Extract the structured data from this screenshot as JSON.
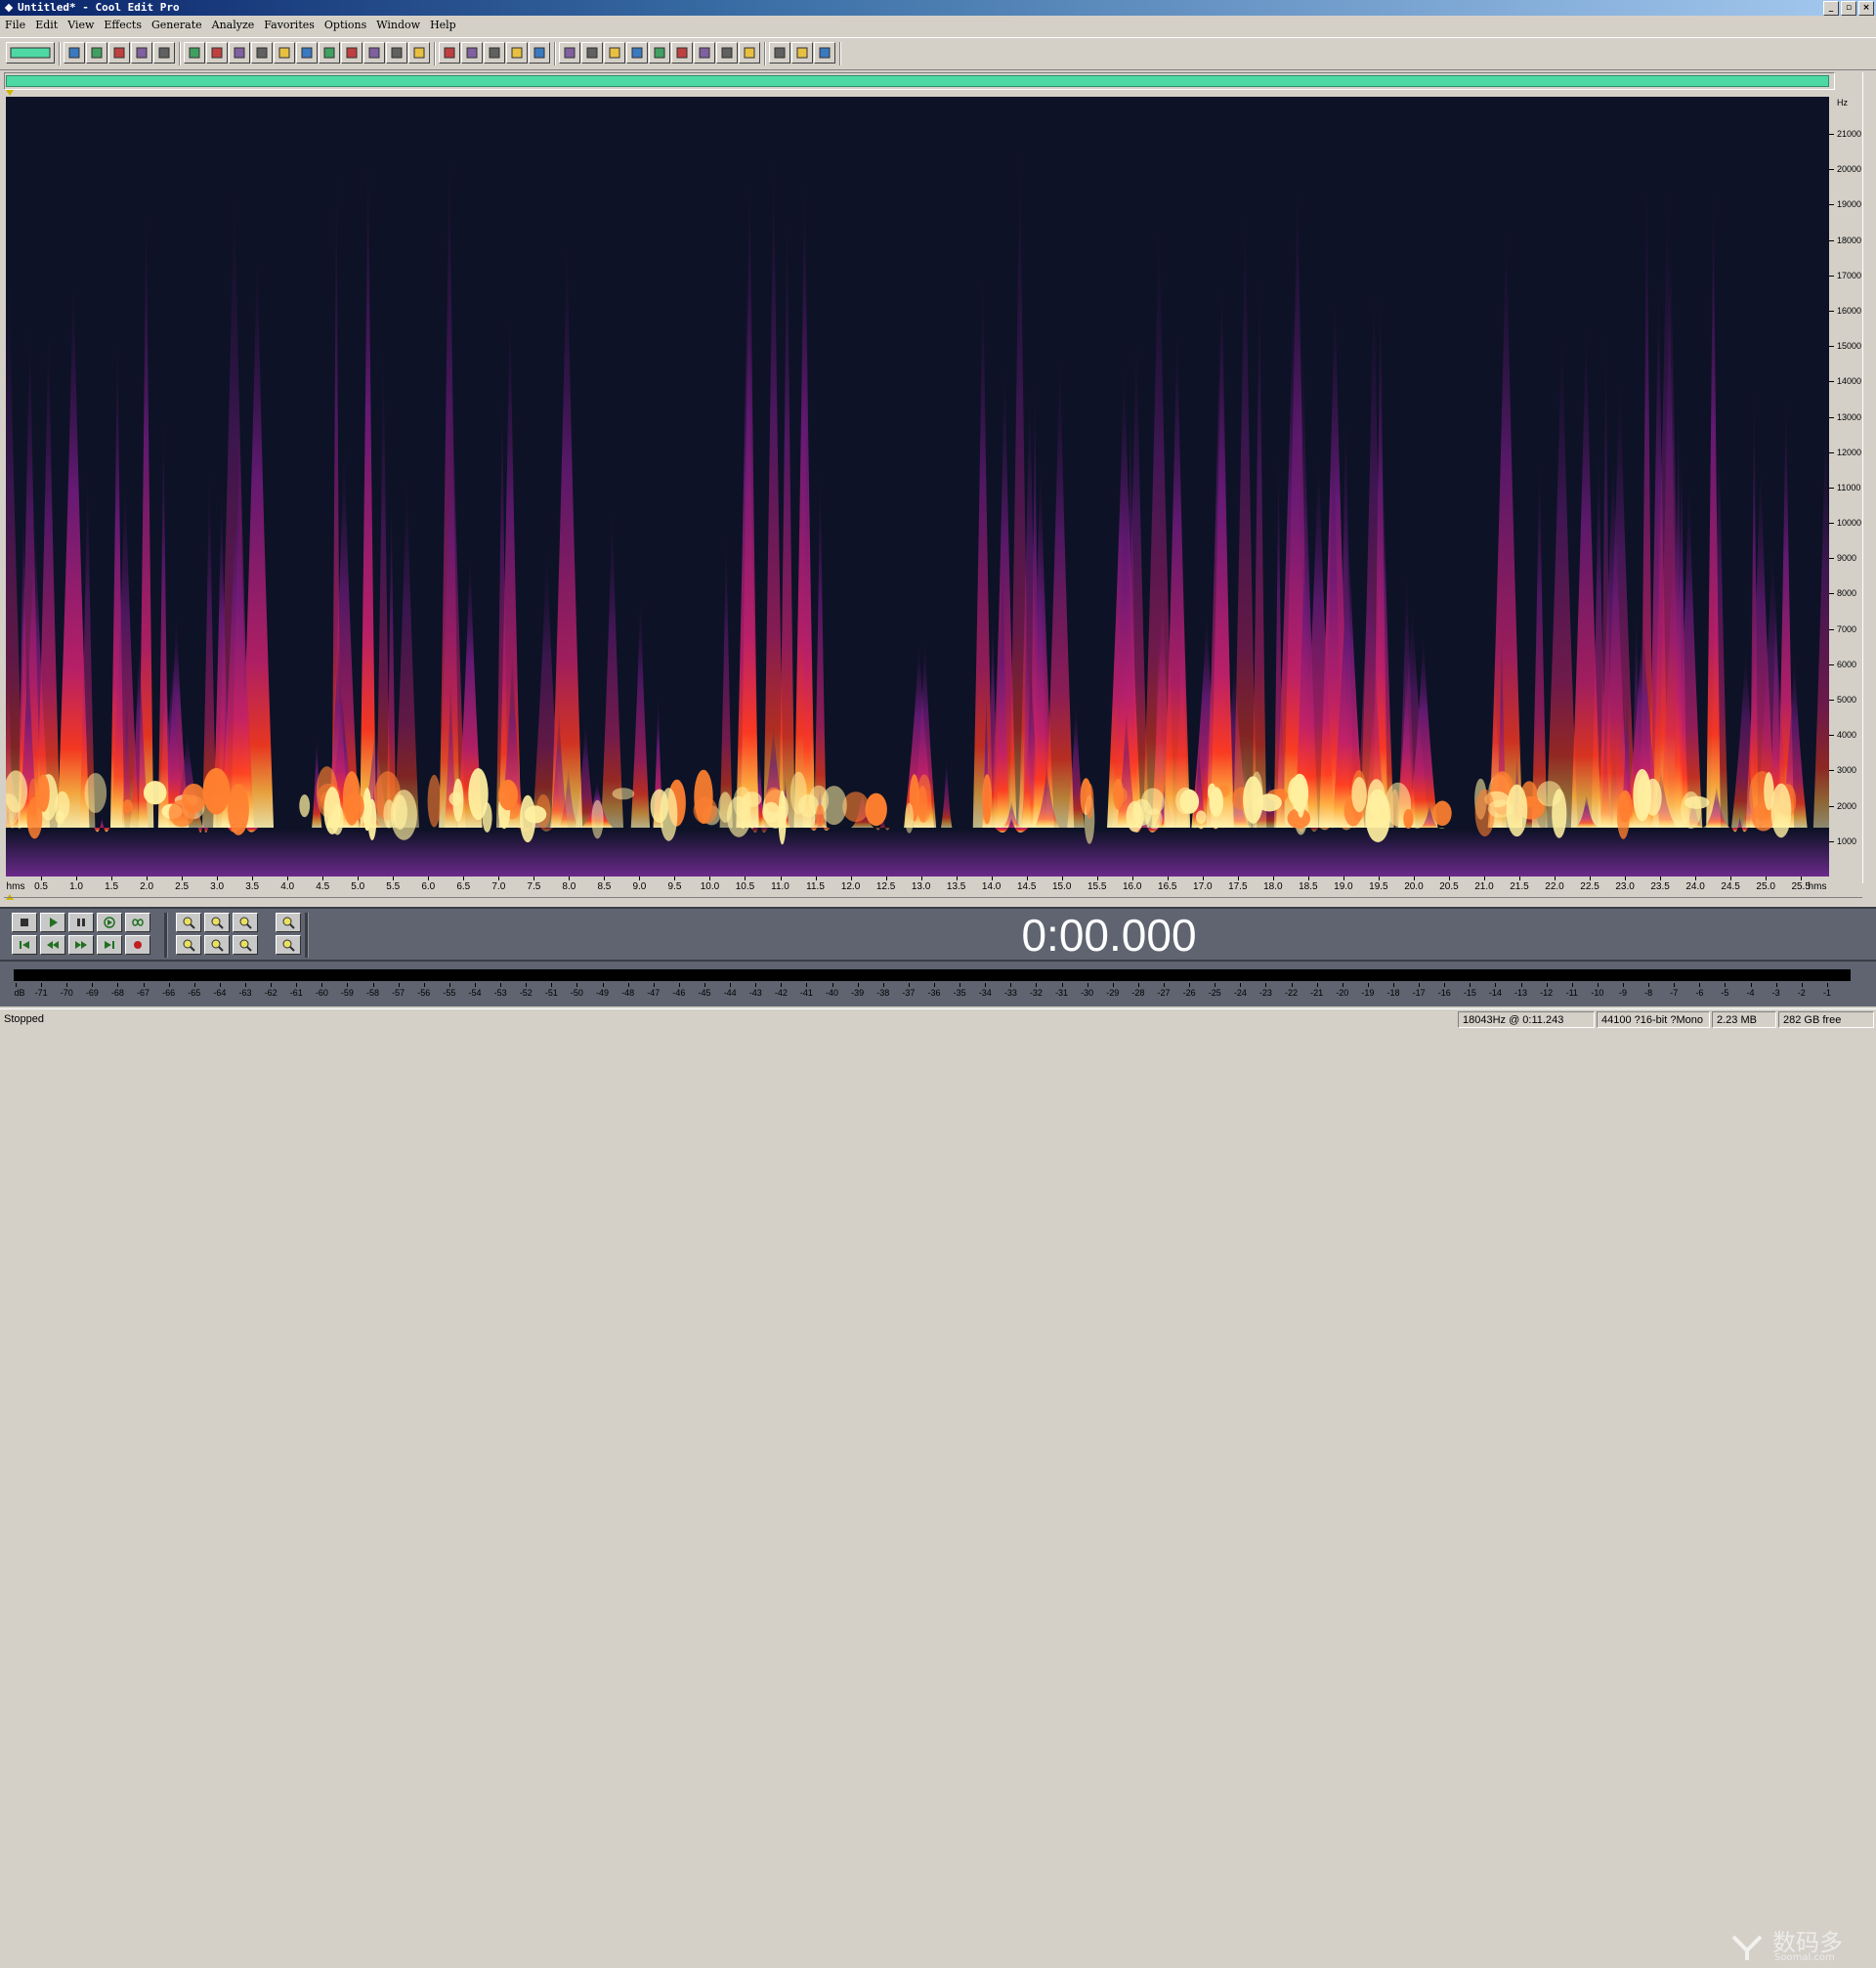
{
  "window": {
    "title": "Untitled* - Cool Edit Pro",
    "buttons": [
      "_",
      "▫",
      "×"
    ]
  },
  "menu": [
    "File",
    "Edit",
    "View",
    "Effects",
    "Generate",
    "Analyze",
    "Favorites",
    "Options",
    "Window",
    "Help"
  ],
  "toolbar": {
    "groups": [
      [
        "waveform-multitrack-toggle"
      ],
      [
        "new-icon",
        "open-icon",
        "save-icon",
        "save-all-icon",
        "close-icon"
      ],
      [
        "undo-icon",
        "redo-icon",
        "repeat-icon",
        "copy-icon",
        "copy-new-icon",
        "cut-icon",
        "paste-icon",
        "paste-new-icon",
        "mix-paste-icon",
        "paste-special-icon",
        "record-icon"
      ],
      [
        "view-waveform-icon",
        "view-envelope-icon",
        "view-spectral-icon",
        "view-spectral-alt-icon",
        "view-phase-icon"
      ],
      [
        "grid-icon",
        "cue-list-icon",
        "play-list-icon",
        "playback-icon",
        "zoom-icon",
        "time-format-icon",
        "snap-icon",
        "status-icon",
        "info-icon"
      ],
      [
        "settings-icon",
        "script-icon",
        "help-icon"
      ]
    ]
  },
  "spectrogram": {
    "hz_unit": "Hz",
    "hz_labels": [
      "21000",
      "20000",
      "19000",
      "18000",
      "17000",
      "16000",
      "15000",
      "14000",
      "13000",
      "12000",
      "11000",
      "10000",
      "9000",
      "8000",
      "7000",
      "6000",
      "5000",
      "4000",
      "3000",
      "2000",
      "1000"
    ],
    "max_hz": 22050,
    "time_labels": [
      "hms",
      "0.5",
      "1.0",
      "1.5",
      "2.0",
      "2.5",
      "3.0",
      "3.5",
      "4.0",
      "4.5",
      "5.0",
      "5.5",
      "6.0",
      "6.5",
      "7.0",
      "7.5",
      "8.0",
      "8.5",
      "9.0",
      "9.5",
      "10.0",
      "10.5",
      "11.0",
      "11.5",
      "12.0",
      "12.5",
      "13.0",
      "13.5",
      "14.0",
      "14.5",
      "15.0",
      "15.5",
      "16.0",
      "16.5",
      "17.0",
      "17.5",
      "18.0",
      "18.5",
      "19.0",
      "19.5",
      "20.0",
      "20.5",
      "21.0",
      "21.5",
      "22.0",
      "22.5",
      "23.0",
      "23.5",
      "24.0",
      "24.5",
      "25.0",
      "25.5",
      "hms"
    ],
    "duration_s": 25.9,
    "colors": {
      "background": "#0d1226",
      "low": "#5a1a6e",
      "mid": "#c0206a",
      "high": "#ff5a1a",
      "peak": "#fff4b0"
    }
  },
  "transport": {
    "time_display": "0:00.000",
    "buttons_row1": [
      "stop-icon",
      "play-icon",
      "pause-icon",
      "play-to-end-icon",
      "loop-icon"
    ],
    "buttons_row2": [
      "go-to-start-icon",
      "rewind-icon",
      "fast-forward-icon",
      "go-to-end-icon",
      "record-icon"
    ],
    "zoom_row1": [
      "zoom-in-icon",
      "zoom-out-icon",
      "zoom-full-icon",
      "zoom-vertical-in-icon"
    ],
    "zoom_row2": [
      "zoom-left-icon",
      "zoom-right-icon",
      "zoom-selection-icon",
      "zoom-vertical-out-icon"
    ]
  },
  "level_meter": {
    "labels": [
      "dB",
      "-71",
      "-70",
      "-69",
      "-68",
      "-67",
      "-66",
      "-65",
      "-64",
      "-63",
      "-62",
      "-61",
      "-60",
      "-59",
      "-58",
      "-57",
      "-56",
      "-55",
      "-54",
      "-53",
      "-52",
      "-51",
      "-50",
      "-49",
      "-48",
      "-47",
      "-46",
      "-45",
      "-44",
      "-43",
      "-42",
      "-41",
      "-40",
      "-39",
      "-38",
      "-37",
      "-36",
      "-35",
      "-34",
      "-33",
      "-32",
      "-31",
      "-30",
      "-29",
      "-28",
      "-27",
      "-26",
      "-25",
      "-24",
      "-23",
      "-22",
      "-21",
      "-20",
      "-19",
      "-18",
      "-17",
      "-16",
      "-15",
      "-14",
      "-13",
      "-12",
      "-11",
      "-10",
      "-9",
      "-8",
      "-7",
      "-6",
      "-5",
      "-4",
      "-3",
      "-2",
      "-1"
    ]
  },
  "status": {
    "state": "Stopped",
    "cursor": "18043Hz @  0:11.243",
    "format": "44100 ?16-bit ?Mono",
    "size": "2.23 MB",
    "free": "282 GB free"
  },
  "watermark": {
    "main": "数码多",
    "sub": "Soomal.com"
  }
}
